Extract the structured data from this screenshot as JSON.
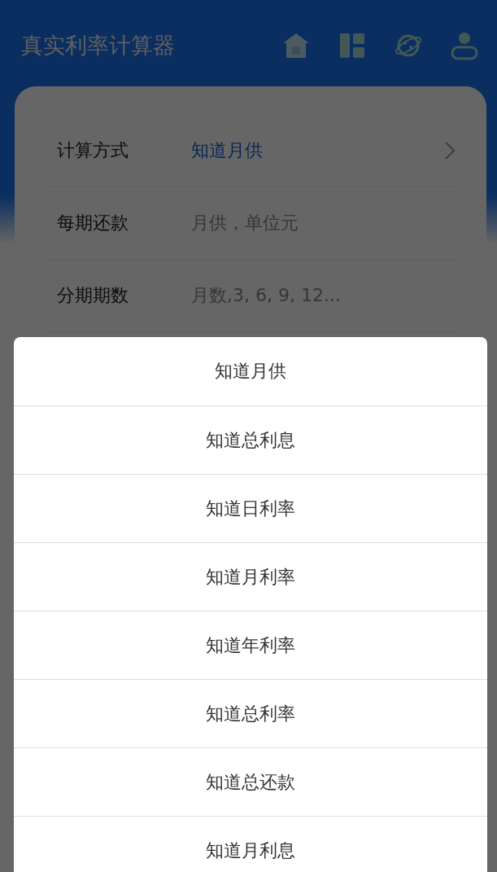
{
  "app_bar": {
    "title": "真实利率计算器"
  },
  "form": {
    "rows": [
      {
        "label": "计算方式",
        "kind": "select",
        "value": "知道月供"
      },
      {
        "label": "每期还款",
        "kind": "input",
        "placeholder": "月供，单位元"
      },
      {
        "label": "分期期数",
        "kind": "input",
        "placeholder": "月数,3, 6, 9, 12..."
      }
    ]
  },
  "action_sheet": {
    "options": [
      "知道月供",
      "知道总利息",
      "知道日利率",
      "知道月利率",
      "知道年利率",
      "知道总利率",
      "知道总还款",
      "知道月利息"
    ]
  }
}
